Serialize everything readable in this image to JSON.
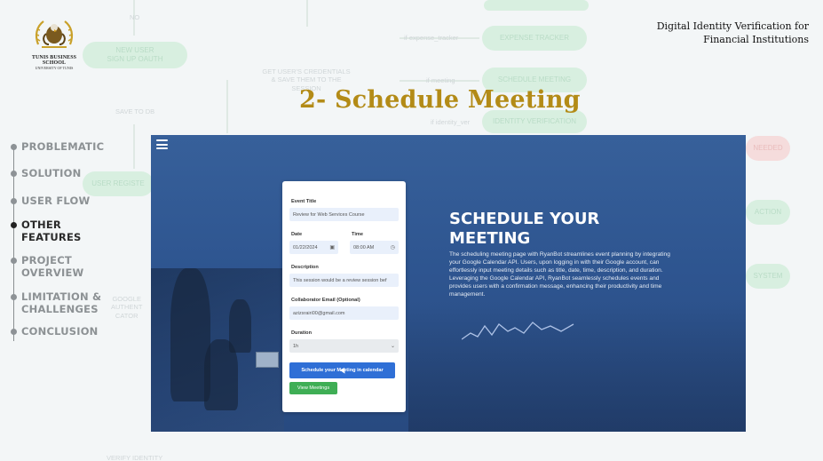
{
  "header": {
    "logo_name": "TUNIS BUSINESS SCHOOL",
    "logo_subtitle": "UNIVERSITY OF TUNIS",
    "project_title_line1": "Digital Identity Verification for",
    "project_title_line2": "Financial Institutions"
  },
  "slide": {
    "title": "2- Schedule Meeting"
  },
  "nav": {
    "items": [
      {
        "label": "PROBLEMATIC",
        "active": false
      },
      {
        "label": "SOLUTION",
        "active": false
      },
      {
        "label": "USER FLOW",
        "active": false
      },
      {
        "label": "OTHER\nFEATURES",
        "active": true
      },
      {
        "label": "PROJECT\nOVERVIEW",
        "active": false
      },
      {
        "label": "LIMITATION &\nCHALLENGES",
        "active": false
      },
      {
        "label": "CONCLUSION",
        "active": false
      }
    ]
  },
  "background_flow": {
    "no": "NO",
    "new_user": "NEW USER\nSIGN UP OAUTH",
    "get_credentials": "GET USER'S CREDENTIALS\n& SAVE THEM TO THE\nSESSION",
    "save_to_db": "SAVE TO DB",
    "user_register": "USER REGISTE",
    "google_auth": "GOOGLE\nAUTHENT\nCATOR",
    "verify_identity": "VERIFY IDENTITY",
    "expense_tracker": "EXPENSE TRACKER",
    "schedule_meeting": "SCHEDULE MEETING",
    "identity_verif": "IDENTITY VERIFICATION",
    "if_expense": "if expense_tracker",
    "if_meeting": "if meeting",
    "if_verif": "if identity_ver",
    "needed": "NEEDED",
    "action": "ACTION",
    "system": "SYSTEM"
  },
  "app": {
    "form": {
      "event_title_label": "Event Title",
      "event_title_value": "Review for Web Services Course",
      "date_label": "Date",
      "date_value": "01/22/2024",
      "time_label": "Time",
      "time_value": "08:00 AM",
      "description_label": "Description",
      "description_value": "This session would be a review session bef",
      "email_label": "Collaborator Email (Optional)",
      "email_value": "azizsrairi00@gmail.com",
      "duration_label": "Duration",
      "duration_value": "1h",
      "schedule_button": "Schedule your Meeting in calendar",
      "view_button": "View Meetings"
    },
    "hero": {
      "title_line1": "SCHEDULE YOUR",
      "title_line2": "MEETING",
      "description": "The scheduling meeting page with RyanBot streamlines event planning by integrating your Google Calendar API. Users, upon logging in with their Google account, can effortlessly input meeting details such as title, date, time, description, and duration. Leveraging the Google Calendar API, RyanBot seamlessly schedules events and provides users with a confirmation message, enhancing their productivity and time management."
    }
  },
  "icons": {
    "menu": "hamburger-icon",
    "calendar": "calendar-icon",
    "clock": "clock-icon",
    "dropdown": "chevron-down-icon",
    "logo": "eagle-crest-logo"
  },
  "colors": {
    "title_gold": "#b38b17",
    "app_blue": "#2e5590",
    "primary_button": "#2f6fd6",
    "secondary_button": "#3fae55"
  }
}
